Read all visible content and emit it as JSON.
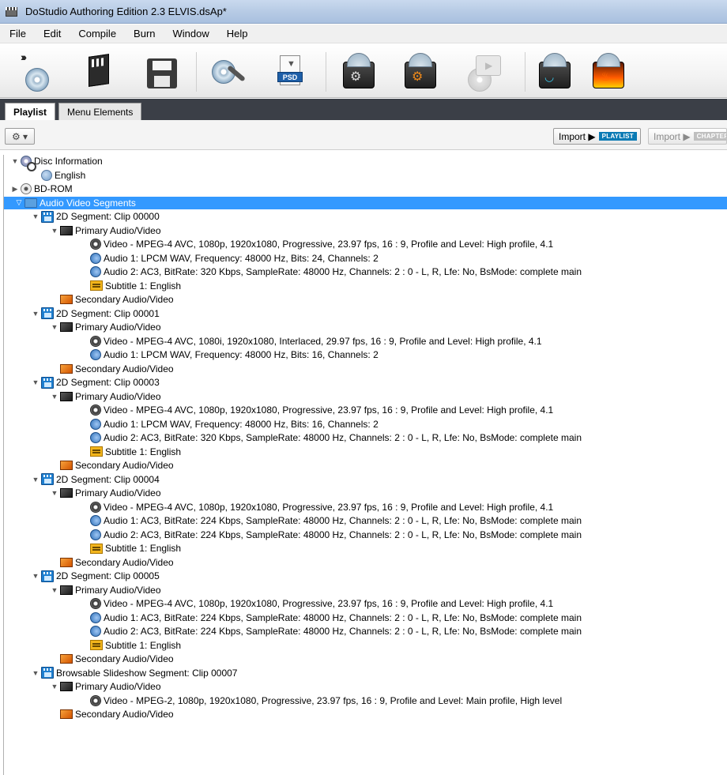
{
  "window": {
    "title": "DoStudio Authoring Edition 2.3 ELVIS.dsAp*"
  },
  "menu": [
    "File",
    "Edit",
    "Compile",
    "Burn",
    "Window",
    "Help"
  ],
  "toolbar": {
    "buttons": [
      {
        "name": "new-project-icon"
      },
      {
        "name": "open-project-icon"
      },
      {
        "name": "save-project-icon"
      },
      {
        "name": "settings-tools-icon"
      },
      {
        "name": "psd-import-icon"
      },
      {
        "name": "compile-gear-icon"
      },
      {
        "name": "compile-orange-gear-icon"
      },
      {
        "name": "preview-disabled-icon"
      },
      {
        "name": "preview-screen-icon"
      },
      {
        "name": "burn-disc-icon"
      }
    ]
  },
  "tabs": {
    "playlist": "Playlist",
    "menu_elements": "Menu Elements"
  },
  "subtoolbar": {
    "gear_label": "⚙ ▾",
    "import_playlist": "Import ▶",
    "import_playlist_badge": "PLAYLIST",
    "import_chapters": "Import ▶",
    "import_chapters_badge": "CHAPTERS"
  },
  "tree": [
    {
      "level": 1,
      "exp": "▼",
      "icon": "disc-info",
      "text": "Disc Information"
    },
    {
      "level": 2,
      "exp": "",
      "icon": "lang",
      "text": "English"
    },
    {
      "level": 1,
      "exp": "▶",
      "icon": "bdrom",
      "text": "BD-ROM"
    },
    {
      "level": 1,
      "exp": "▽",
      "icon": "folder",
      "text": "Audio Video Segments",
      "selected": true
    },
    {
      "level": 2,
      "exp": "▼",
      "icon": "seg",
      "text": "2D Segment: Clip 00000"
    },
    {
      "level": 3,
      "exp": "▼",
      "icon": "prim",
      "text": "Primary Audio/Video"
    },
    {
      "level": 4,
      "exp": "",
      "icon": "video",
      "text": "Video - MPEG-4 AVC, 1080p,  1920x1080,  Progressive,  23.97 fps,  16 : 9,  Profile and Level: High profile,  4.1"
    },
    {
      "level": 4,
      "exp": "",
      "icon": "audio",
      "text": "Audio 1: LPCM WAV, Frequency: 48000 Hz, Bits: 24, Channels: 2"
    },
    {
      "level": 4,
      "exp": "",
      "icon": "audio",
      "text": "Audio 2: AC3, BitRate: 320 Kbps, SampleRate: 48000 Hz, Channels: 2 : 0 - L, R, Lfe: No, BsMode: complete main"
    },
    {
      "level": 4,
      "exp": "",
      "icon": "sub",
      "text": "Subtitle 1: English"
    },
    {
      "level": 3,
      "exp": "",
      "icon": "sec",
      "text": "Secondary Audio/Video"
    },
    {
      "level": 2,
      "exp": "▼",
      "icon": "seg",
      "text": "2D Segment: Clip 00001"
    },
    {
      "level": 3,
      "exp": "▼",
      "icon": "prim",
      "text": "Primary Audio/Video"
    },
    {
      "level": 4,
      "exp": "",
      "icon": "video",
      "text": "Video - MPEG-4 AVC, 1080i,  1920x1080,  Interlaced,  29.97 fps,  16 : 9,  Profile and Level: High profile,  4.1"
    },
    {
      "level": 4,
      "exp": "",
      "icon": "audio",
      "text": "Audio 1: LPCM WAV, Frequency: 48000 Hz, Bits: 16, Channels: 2"
    },
    {
      "level": 3,
      "exp": "",
      "icon": "sec",
      "text": "Secondary Audio/Video"
    },
    {
      "level": 2,
      "exp": "▼",
      "icon": "seg",
      "text": "2D Segment: Clip 00003"
    },
    {
      "level": 3,
      "exp": "▼",
      "icon": "prim",
      "text": "Primary Audio/Video"
    },
    {
      "level": 4,
      "exp": "",
      "icon": "video",
      "text": "Video - MPEG-4 AVC, 1080p,  1920x1080,  Progressive,  23.97 fps,  16 : 9,  Profile and Level: High profile,  4.1"
    },
    {
      "level": 4,
      "exp": "",
      "icon": "audio",
      "text": "Audio 1: LPCM WAV, Frequency: 48000 Hz, Bits: 16, Channels: 2"
    },
    {
      "level": 4,
      "exp": "",
      "icon": "audio",
      "text": "Audio 2: AC3, BitRate: 320 Kbps, SampleRate: 48000 Hz, Channels: 2 : 0 - L, R, Lfe: No, BsMode: complete main"
    },
    {
      "level": 4,
      "exp": "",
      "icon": "sub",
      "text": "Subtitle 1: English"
    },
    {
      "level": 3,
      "exp": "",
      "icon": "sec",
      "text": "Secondary Audio/Video"
    },
    {
      "level": 2,
      "exp": "▼",
      "icon": "seg",
      "text": "2D Segment: Clip 00004"
    },
    {
      "level": 3,
      "exp": "▼",
      "icon": "prim",
      "text": "Primary Audio/Video"
    },
    {
      "level": 4,
      "exp": "",
      "icon": "video",
      "text": "Video - MPEG-4 AVC, 1080p,  1920x1080,  Progressive,  23.97 fps,  16 : 9,  Profile and Level: High profile,  4.1"
    },
    {
      "level": 4,
      "exp": "",
      "icon": "audio",
      "text": "Audio 1: AC3, BitRate: 224 Kbps, SampleRate: 48000 Hz, Channels: 2 : 0 - L, R, Lfe: No, BsMode: complete main"
    },
    {
      "level": 4,
      "exp": "",
      "icon": "audio",
      "text": "Audio 2: AC3, BitRate: 224 Kbps, SampleRate: 48000 Hz, Channels: 2 : 0 - L, R, Lfe: No, BsMode: complete main"
    },
    {
      "level": 4,
      "exp": "",
      "icon": "sub",
      "text": "Subtitle 1: English"
    },
    {
      "level": 3,
      "exp": "",
      "icon": "sec",
      "text": "Secondary Audio/Video"
    },
    {
      "level": 2,
      "exp": "▼",
      "icon": "seg",
      "text": "2D Segment: Clip 00005"
    },
    {
      "level": 3,
      "exp": "▼",
      "icon": "prim",
      "text": "Primary Audio/Video"
    },
    {
      "level": 4,
      "exp": "",
      "icon": "video",
      "text": "Video - MPEG-4 AVC, 1080p,  1920x1080,  Progressive,  23.97 fps,  16 : 9,  Profile and Level: High profile,  4.1"
    },
    {
      "level": 4,
      "exp": "",
      "icon": "audio",
      "text": "Audio 1: AC3, BitRate: 224 Kbps, SampleRate: 48000 Hz, Channels: 2 : 0 - L, R, Lfe: No, BsMode: complete main"
    },
    {
      "level": 4,
      "exp": "",
      "icon": "audio",
      "text": "Audio 2: AC3, BitRate: 224 Kbps, SampleRate: 48000 Hz, Channels: 2 : 0 - L, R, Lfe: No, BsMode: complete main"
    },
    {
      "level": 4,
      "exp": "",
      "icon": "sub",
      "text": "Subtitle 1: English"
    },
    {
      "level": 3,
      "exp": "",
      "icon": "sec",
      "text": "Secondary Audio/Video"
    },
    {
      "level": 2,
      "exp": "▼",
      "icon": "seg",
      "text": "Browsable Slideshow Segment: Clip 00007"
    },
    {
      "level": 3,
      "exp": "▼",
      "icon": "prim",
      "text": "Primary Audio/Video"
    },
    {
      "level": 4,
      "exp": "",
      "icon": "video",
      "text": "Video - MPEG-2, 1080p,  1920x1080,  Progressive,  23.97 fps,  16 : 9,  Profile and Level: Main profile,  High level"
    },
    {
      "level": 3,
      "exp": "",
      "icon": "sec",
      "text": "Secondary Audio/Video"
    }
  ]
}
